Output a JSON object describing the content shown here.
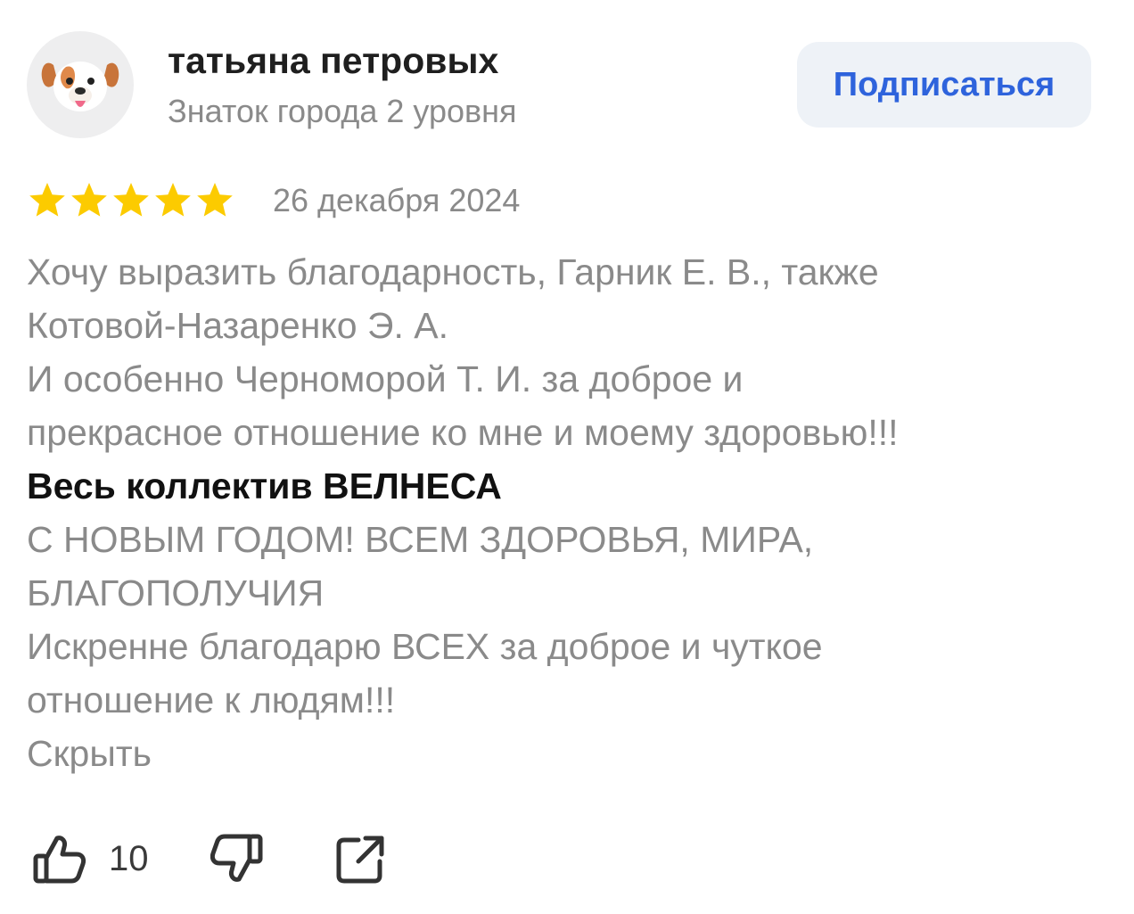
{
  "author": {
    "name": "татьяна петровых",
    "rank": "Знаток города 2 уровня",
    "avatar_icon": "puppy-face-icon"
  },
  "subscribe": {
    "label": "Подписаться"
  },
  "review": {
    "rating": 5,
    "rating_max": 5,
    "date": "26 декабря 2024",
    "lines": [
      {
        "text": "Хочу выразить благодарность, Гарник Е. В., также",
        "emphasis": false
      },
      {
        "text": "Котовой-Назаренко Э. А.",
        "emphasis": false
      },
      {
        "text": "И особенно Черноморой Т. И. за доброе и",
        "emphasis": false
      },
      {
        "text": "прекрасное отношение ко мне и моему здоровью!!!",
        "emphasis": false
      },
      {
        "text": "Весь коллектив ВЕЛНЕСА",
        "emphasis": true
      },
      {
        "text": "С НОВЫМ ГОДОМ! ВСЕМ ЗДОРОВЬЯ, МИРА,",
        "emphasis": false
      },
      {
        "text": "БЛАГОПОЛУЧИЯ",
        "emphasis": false
      },
      {
        "text": "Искренне благодарю ВСЕХ за доброе и чуткое",
        "emphasis": false
      },
      {
        "text": "отношение к людям!!!",
        "emphasis": false
      }
    ],
    "collapse_label": "Скрыть"
  },
  "actions": {
    "likes": "10",
    "like_icon": "thumbs-up-icon",
    "dislike_icon": "thumbs-down-icon",
    "share_icon": "share-icon"
  },
  "colors": {
    "star": "#fccb00",
    "accent": "#2e63dc",
    "secondary_text": "#8a8a8a"
  }
}
